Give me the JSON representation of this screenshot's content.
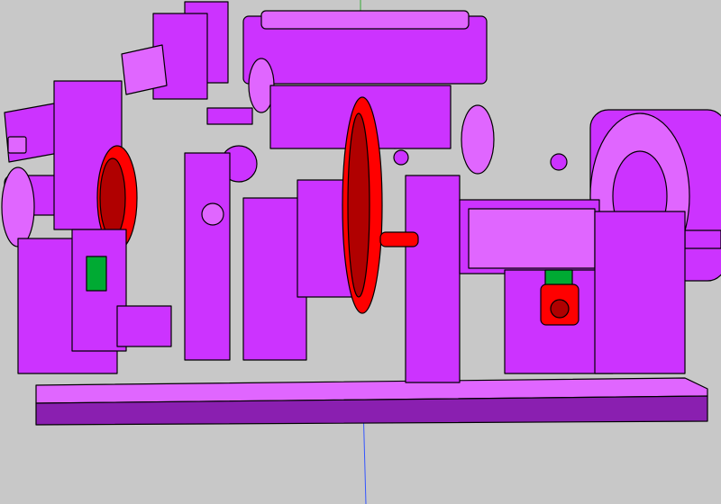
{
  "viewport": {
    "background": "#c8c8c8"
  },
  "palette": {
    "body": "#cc33ff",
    "body_light": "#e066ff",
    "body_dark": "#8a1fb0",
    "outline": "#000000",
    "accent_red": "#ff0000",
    "accent_red_dark": "#b00000",
    "accent_green": "#00aa33",
    "axis_green": "#33aa33",
    "axis_blue": "#3355ff"
  }
}
